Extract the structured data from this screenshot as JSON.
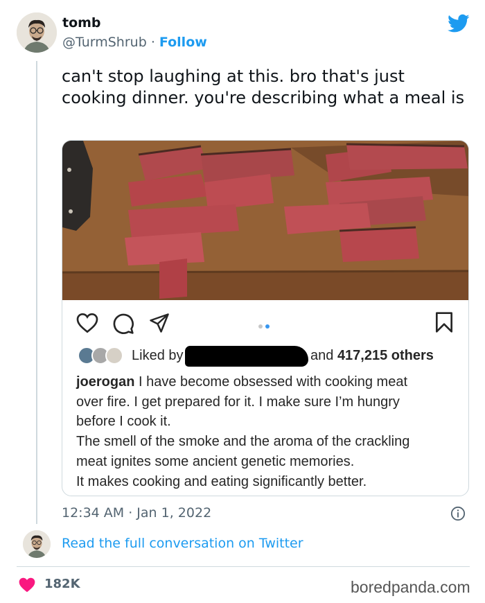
{
  "author": {
    "name": "tomb",
    "handle": "@TurmShrub",
    "separator": "·",
    "follow_label": "Follow"
  },
  "tweet": {
    "text": "can't stop laughing at this. bro that's just cooking dinner. you're describing what a meal is",
    "timestamp": "12:34 AM · Jan 1, 2022"
  },
  "embedded_post": {
    "liked_by_prefix": "Liked by",
    "liked_by_suffix": "and",
    "others_count": "417,215 others",
    "caption_user": "joerogan",
    "caption_lines": [
      "I have become obsessed with cooking meat",
      "over fire.  I get prepared for it.  I make sure I’m hungry",
      "before I cook it.",
      "The smell of the smoke and the aroma of the crackling",
      "meat ignites some ancient genetic memories.",
      "It makes cooking and eating significantly better."
    ]
  },
  "footer": {
    "read_more": "Read the full conversation on Twitter",
    "like_count": "182K"
  },
  "watermark": "boredpanda.com",
  "colors": {
    "accent": "#1d9bf0",
    "heart": "#f91880",
    "muted_text": "#536471",
    "ig_dot_active": "#3897f0"
  },
  "icons": {
    "twitter_logo": "bird-icon",
    "ig_like": "heart-outline-icon",
    "ig_comment": "comment-icon",
    "ig_share": "send-icon",
    "ig_save": "bookmark-icon",
    "info": "info-icon",
    "like": "heart-filled-icon"
  }
}
